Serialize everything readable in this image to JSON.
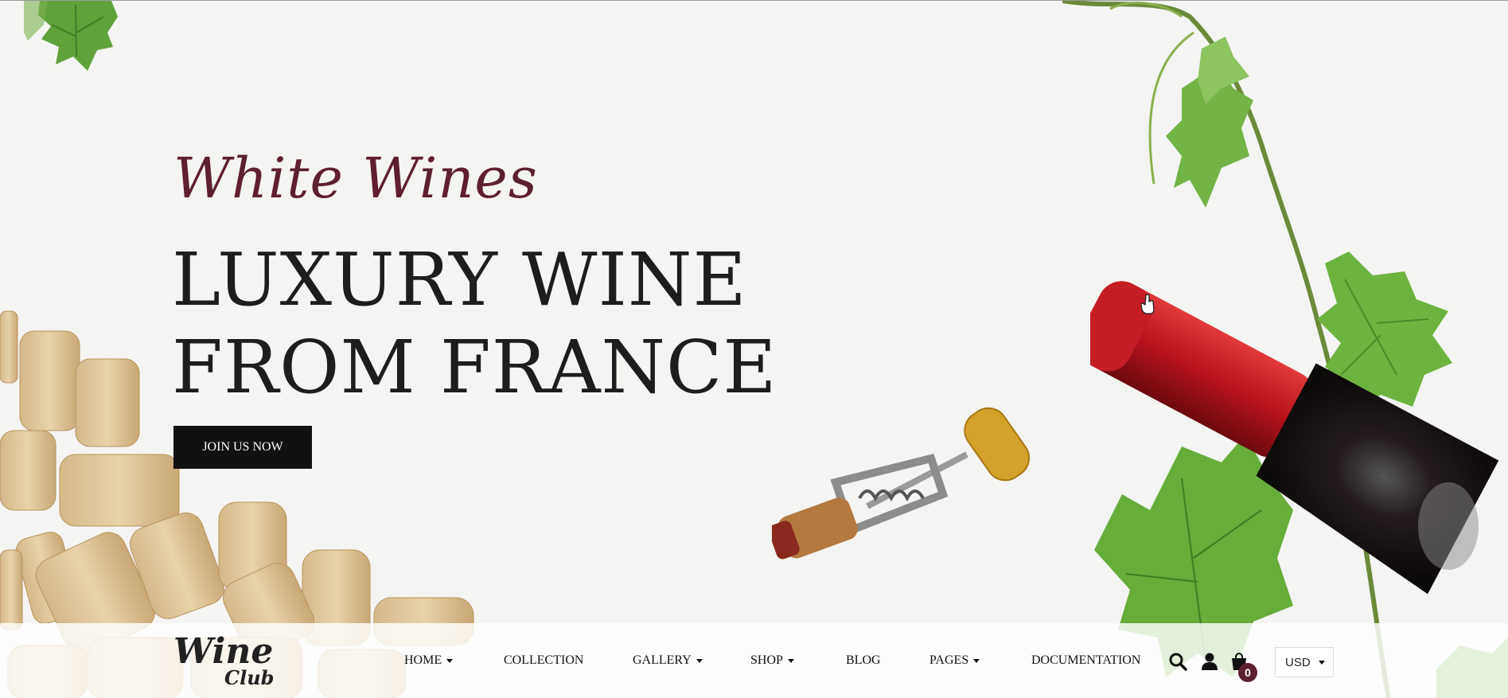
{
  "hero": {
    "subtitle": "White Wines",
    "headline_line1": "LUXURY WINE",
    "headline_line2": "FROM FRANCE",
    "cta_label": "JOIN US NOW"
  },
  "logo": {
    "word": "Wine",
    "club": "Club"
  },
  "nav": {
    "items": [
      {
        "label": "HOME",
        "has_dropdown": true
      },
      {
        "label": "COLLECTION",
        "has_dropdown": false
      },
      {
        "label": "GALLERY",
        "has_dropdown": true
      },
      {
        "label": "SHOP",
        "has_dropdown": true
      },
      {
        "label": "BLOG",
        "has_dropdown": false
      },
      {
        "label": "PAGES",
        "has_dropdown": true
      },
      {
        "label": "DOCUMENTATION",
        "has_dropdown": false
      }
    ]
  },
  "header_icons": {
    "search": "search-icon",
    "account": "user-icon",
    "cart": "shopping-bag-icon",
    "cart_count": "0"
  },
  "currency": {
    "selected": "USD"
  },
  "colors": {
    "accent": "#5e1f2f",
    "cta_bg": "#111111",
    "background": "#f4f4f2"
  }
}
